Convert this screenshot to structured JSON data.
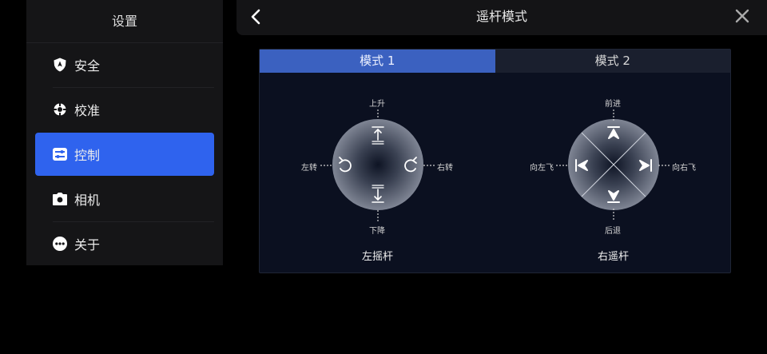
{
  "sidebar": {
    "title": "设置",
    "items": [
      {
        "label": "安全",
        "icon": "shield-icon"
      },
      {
        "label": "校准",
        "icon": "calibrate-icon"
      },
      {
        "label": "控制",
        "icon": "sliders-icon"
      },
      {
        "label": "相机",
        "icon": "camera-icon"
      },
      {
        "label": "关于",
        "icon": "more-icon"
      }
    ],
    "active_index": 2
  },
  "header": {
    "title": "遥杆模式"
  },
  "tabs": [
    {
      "label": "模式 1"
    },
    {
      "label": "模式 2"
    }
  ],
  "active_tab": 0,
  "left_stick": {
    "name": "左摇杆",
    "up": "上升",
    "down": "下降",
    "left": "左转",
    "right": "右转"
  },
  "right_stick": {
    "name": "右遥杆",
    "up": "前进",
    "down": "后退",
    "left": "向左飞",
    "right": "向右飞"
  },
  "colors": {
    "accent": "#2f63ee",
    "tab_active": "#3b61c0",
    "panel_bg": "#0b1020"
  }
}
